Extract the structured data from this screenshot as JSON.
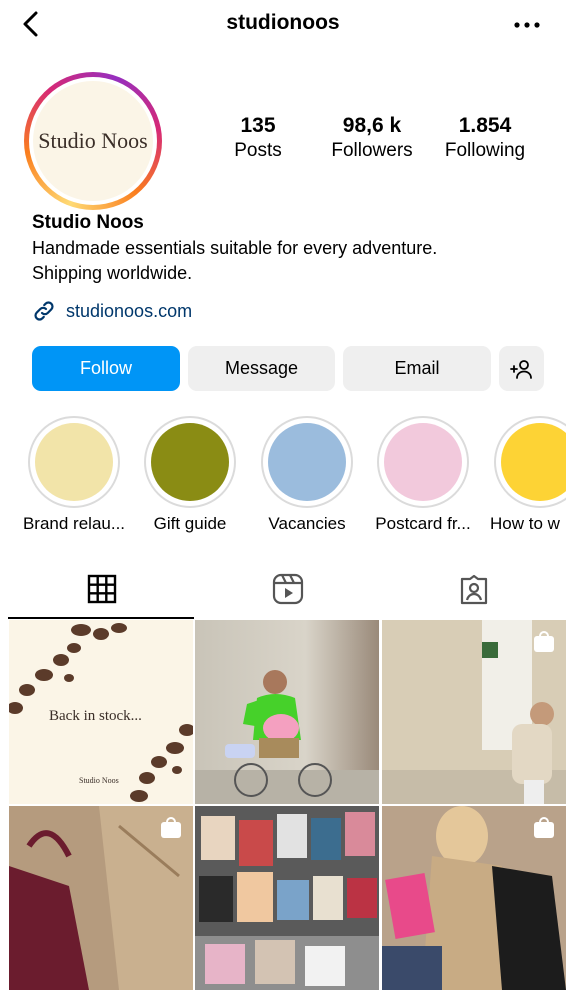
{
  "header": {
    "username": "studionoos"
  },
  "profile": {
    "avatar_text": "Studio Noos",
    "stats": [
      {
        "value": "135",
        "label": "Posts"
      },
      {
        "value": "98,6 k",
        "label": "Followers"
      },
      {
        "value": "1.854",
        "label": "Following"
      }
    ],
    "display_name": "Studio Noos",
    "bio_lines": [
      "Handmade essentials suitable for every adventure.",
      "Shipping worldwide."
    ],
    "link": "studionoos.com"
  },
  "actions": {
    "follow": "Follow",
    "message": "Message",
    "email": "Email"
  },
  "highlights": [
    {
      "label": "Brand relau...",
      "color": "#f2e4a9"
    },
    {
      "label": "Gift guide",
      "color": "#8a8c14"
    },
    {
      "label": "Vacancies",
      "color": "#9bbcdd"
    },
    {
      "label": "Postcard fr...",
      "color": "#f2c9dc"
    },
    {
      "label": "How to w",
      "color": "#fdd335"
    }
  ],
  "posts": [
    {
      "caption": "Back in stock...",
      "brand": "Studio Noos"
    }
  ],
  "colors": {
    "accent": "#0095f6",
    "link": "#00376b"
  }
}
